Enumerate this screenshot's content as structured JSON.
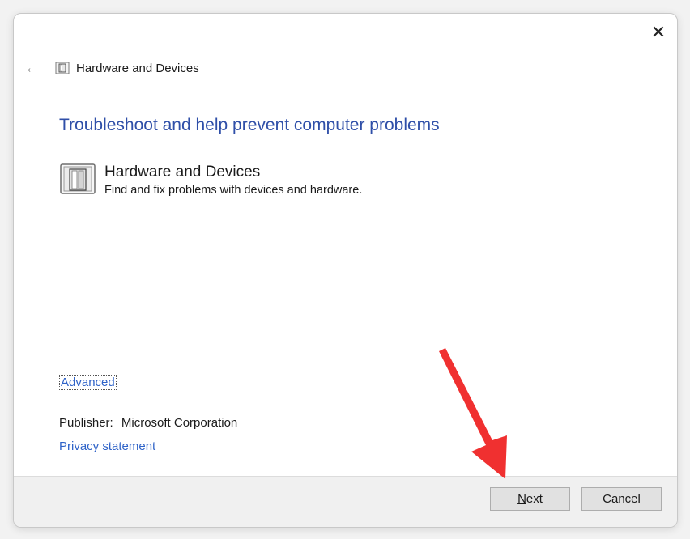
{
  "window": {
    "close_glyph": "✕",
    "nav": {
      "back_glyph": "←",
      "title": "Hardware and Devices"
    }
  },
  "main": {
    "heading": "Troubleshoot and help prevent computer problems",
    "troubleshooter": {
      "title": "Hardware and Devices",
      "description": "Find and fix problems with devices and hardware."
    },
    "advanced_link": "Advanced",
    "publisher_label": "Publisher:",
    "publisher_value": "Microsoft Corporation",
    "privacy_link": "Privacy statement"
  },
  "footer": {
    "next_mnemonic": "N",
    "next_rest": "ext",
    "cancel_label": "Cancel"
  },
  "colors": {
    "heading": "#2f4fa8",
    "link": "#2f63c8",
    "annotation_arrow": "#f03030"
  },
  "icons": {
    "troubleshooter_icon": "hardware-device-icon",
    "annotation": "red-arrow-pointing-to-next"
  }
}
